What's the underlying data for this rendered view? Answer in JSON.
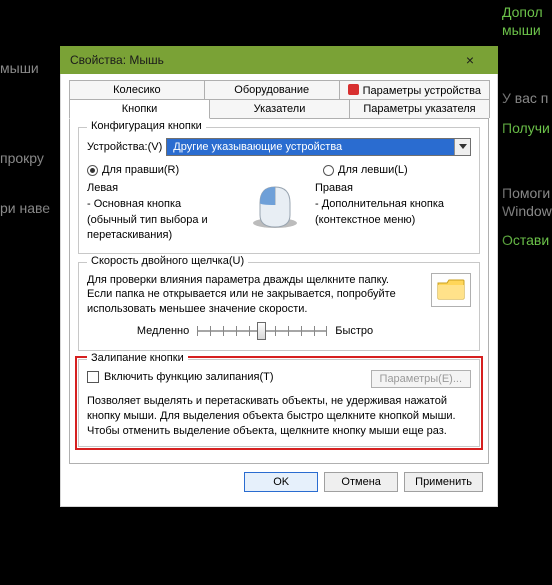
{
  "bg": {
    "t1": "Допол",
    "t2": "мыши",
    "t3": "мыши",
    "t4": "прокру",
    "t5": "ри наве",
    "t6": "У вас п",
    "t7": "Получи",
    "t8": "Помоги",
    "t9": "Window",
    "t10": "Остави"
  },
  "window": {
    "title": "Свойства: Мышь",
    "close": "×"
  },
  "tabs": {
    "row1": {
      "wheel": "Колесико",
      "hardware": "Оборудование",
      "device": "Параметры устройства"
    },
    "row2": {
      "buttons": "Кнопки",
      "pointers": "Указатели",
      "pointeropts": "Параметры указателя"
    }
  },
  "group1": {
    "legend": "Конфигурация кнопки",
    "devices_label": "Устройства:(V)",
    "devices_value": "Другие указывающие устройства",
    "radio_right": "Для правши(R)",
    "radio_left": "Для левши(L)",
    "left_title": "Левая",
    "left_line1": "- Основная кнопка",
    "left_line2": "(обычный тип выбора и",
    "left_line3": "перетаскивания)",
    "right_title": "Правая",
    "right_line1": "- Дополнительная кнопка",
    "right_line2": "(контекстное меню)"
  },
  "group2": {
    "legend": "Скорость двойного щелчка(U)",
    "text1": "Для проверки влияния параметра дважды щелкните папку.",
    "text2": "Если папка не открывается или не закрывается, попробуйте",
    "text3": "использовать меньшее значение скорости.",
    "slow": "Медленно",
    "fast": "Быстро"
  },
  "group3": {
    "legend": "Залипание кнопки",
    "checkbox_label": "Включить функцию залипания(T)",
    "params_btn": "Параметры(E)...",
    "help1": "Позволяет выделять и перетаскивать объекты, не удерживая нажатой",
    "help2": "кнопку мыши. Для выделения объекта быстро щелкните кнопкой мыши.",
    "help3": "Чтобы отменить выделение объекта, щелкните кнопку мыши еще раз."
  },
  "buttons": {
    "ok": "OK",
    "cancel": "Отмена",
    "apply": "Применить"
  }
}
